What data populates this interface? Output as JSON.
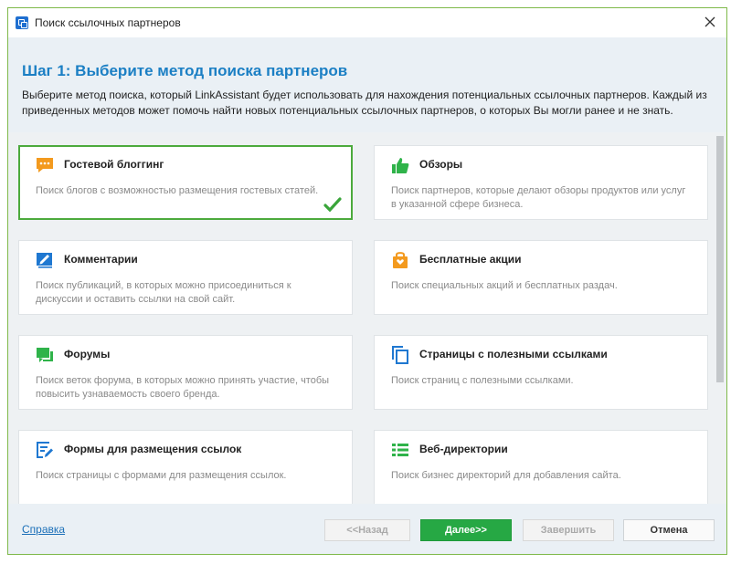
{
  "window": {
    "title": "Поиск ссылочных партнеров"
  },
  "header": {
    "step_title": "Шаг 1: Выберите метод поиска партнеров",
    "description": "Выберите метод поиска, который LinkAssistant будет использовать для нахождения потенциальных ссылочных партнеров. Каждый из приведенных методов  может помочь найти новых потенциальных ссылочных партнеров, о которых Вы могли ранее и не знать."
  },
  "cards": [
    {
      "title": "Гостевой блоггинг",
      "desc": "Поиск блогов с возможностью размещения гостевых статей.",
      "icon": "chat-bubble-icon",
      "selected": true
    },
    {
      "title": "Обзоры",
      "desc": "Поиск партнеров, которые делают обзоры продуктов или услуг в указанной сфере бизнеса.",
      "icon": "thumbs-up-icon",
      "selected": false
    },
    {
      "title": "Комментарии",
      "desc": "Поиск публикаций, в которых можно присоединиться к дискуссии и оставить ссылки на свой сайт.",
      "icon": "pencil-square-icon",
      "selected": false
    },
    {
      "title": "Бесплатные акции",
      "desc": "Поиск специальных акций и бесплатных раздач.",
      "icon": "gift-bag-icon",
      "selected": false
    },
    {
      "title": "Форумы",
      "desc": "Поиск веток форума, в которых можно принять участие, чтобы повысить узнаваемость своего бренда.",
      "icon": "forum-icon",
      "selected": false
    },
    {
      "title": "Страницы с полезными ссылками",
      "desc": "Поиск страниц с полезными ссылками.",
      "icon": "copy-pages-icon",
      "selected": false
    },
    {
      "title": "Формы для размещения ссылок",
      "desc": "Поиск страницы с формами для размещения ссылок.",
      "icon": "form-edit-icon",
      "selected": false
    },
    {
      "title": "Веб-директории",
      "desc": "Поиск бизнес директорий для добавления сайта.",
      "icon": "list-icon",
      "selected": false
    }
  ],
  "footer": {
    "help": "Справка",
    "back": "<<Назад",
    "next": "Далее>>",
    "finish": "Завершить",
    "cancel": "Отмена"
  },
  "colors": {
    "accent_blue": "#1b7fc4",
    "selected_green": "#4caa3c",
    "icon_orange": "#f39a1e",
    "icon_green": "#2fb34a",
    "icon_blue": "#1f78d1"
  }
}
